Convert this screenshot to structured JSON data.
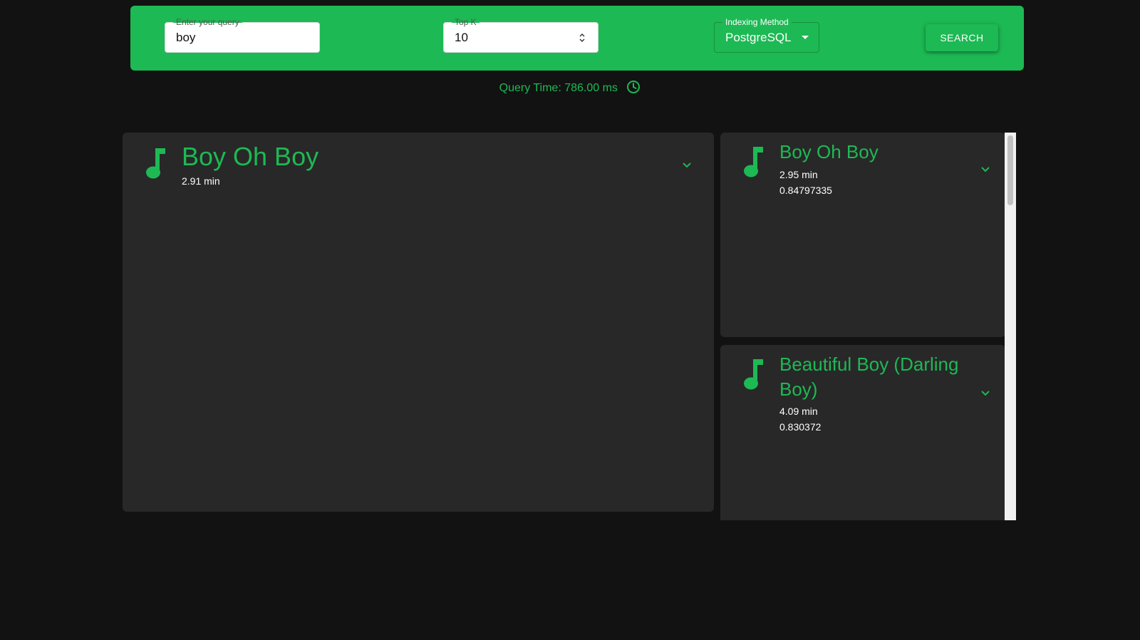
{
  "search": {
    "query_label": "Enter your query",
    "query_value": "boy",
    "topk_label": "Top K",
    "topk_value": "10",
    "method_label": "Indexing Method",
    "method_value": "PostgreSQL",
    "button_label": "SEARCH"
  },
  "status": {
    "query_time": "Query Time: 786.00 ms"
  },
  "featured": {
    "title": "Boy Oh Boy",
    "duration": "2.91 min"
  },
  "results": [
    {
      "title": "Boy Oh Boy",
      "duration": "2.95 min",
      "score": "0.84797335"
    },
    {
      "title": "Beautiful Boy (Darling Boy)",
      "duration": "4.09 min",
      "score": "0.830372"
    }
  ],
  "colors": {
    "accent": "#1db954",
    "background": "#121212",
    "card": "#282828"
  },
  "icons": {
    "track": "music-note-icon",
    "expand": "chevron-down-icon",
    "time": "clock-icon"
  }
}
